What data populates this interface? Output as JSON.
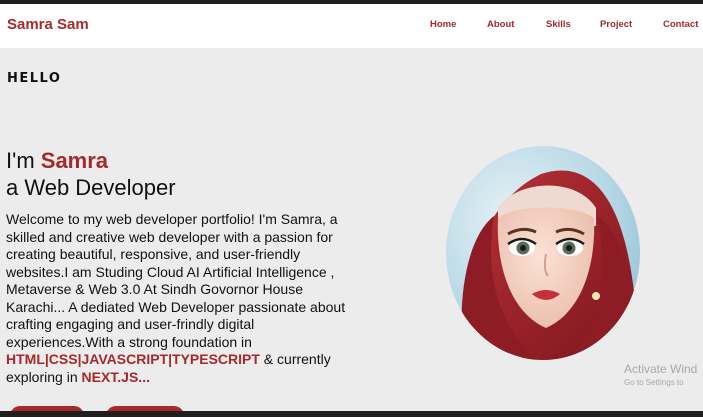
{
  "header": {
    "brand": "Samra Sam",
    "nav": [
      "Home",
      "About",
      "Skills",
      "Project",
      "Contact"
    ]
  },
  "hero": {
    "hello": "HELLO",
    "greeting_prefix": "I'm ",
    "greeting_name": "Samra",
    "role": "a Web Developer",
    "bio_1": "Welcome to my web developer portfolio! I'm Samra, a skilled and creative web developer with a passion for creating beautiful, responsive, and user-friendly websites.I am Studing Cloud AI Artificial Intelligence , Metaverse & Web 3.0 At Sindh Govornor House Karachi... A dediated Web Developer passionate about crafting engaging and user-frindly digital experiences.With a strong foundation in ",
    "bio_skills": "HTML|CSS|JAVASCRIPT|TYPESCRIPT",
    "bio_2": " & currently exploring in ",
    "bio_next": "NEXT.JS...",
    "profile_image": "hijab-avatar-portrait"
  },
  "watermark": {
    "line1": "Activate Wind",
    "line2": "Go to Settings to"
  },
  "colors": {
    "accent": "#a52a2a",
    "background": "#ececec",
    "header_bg": "#ffffff",
    "text": "#111111"
  }
}
